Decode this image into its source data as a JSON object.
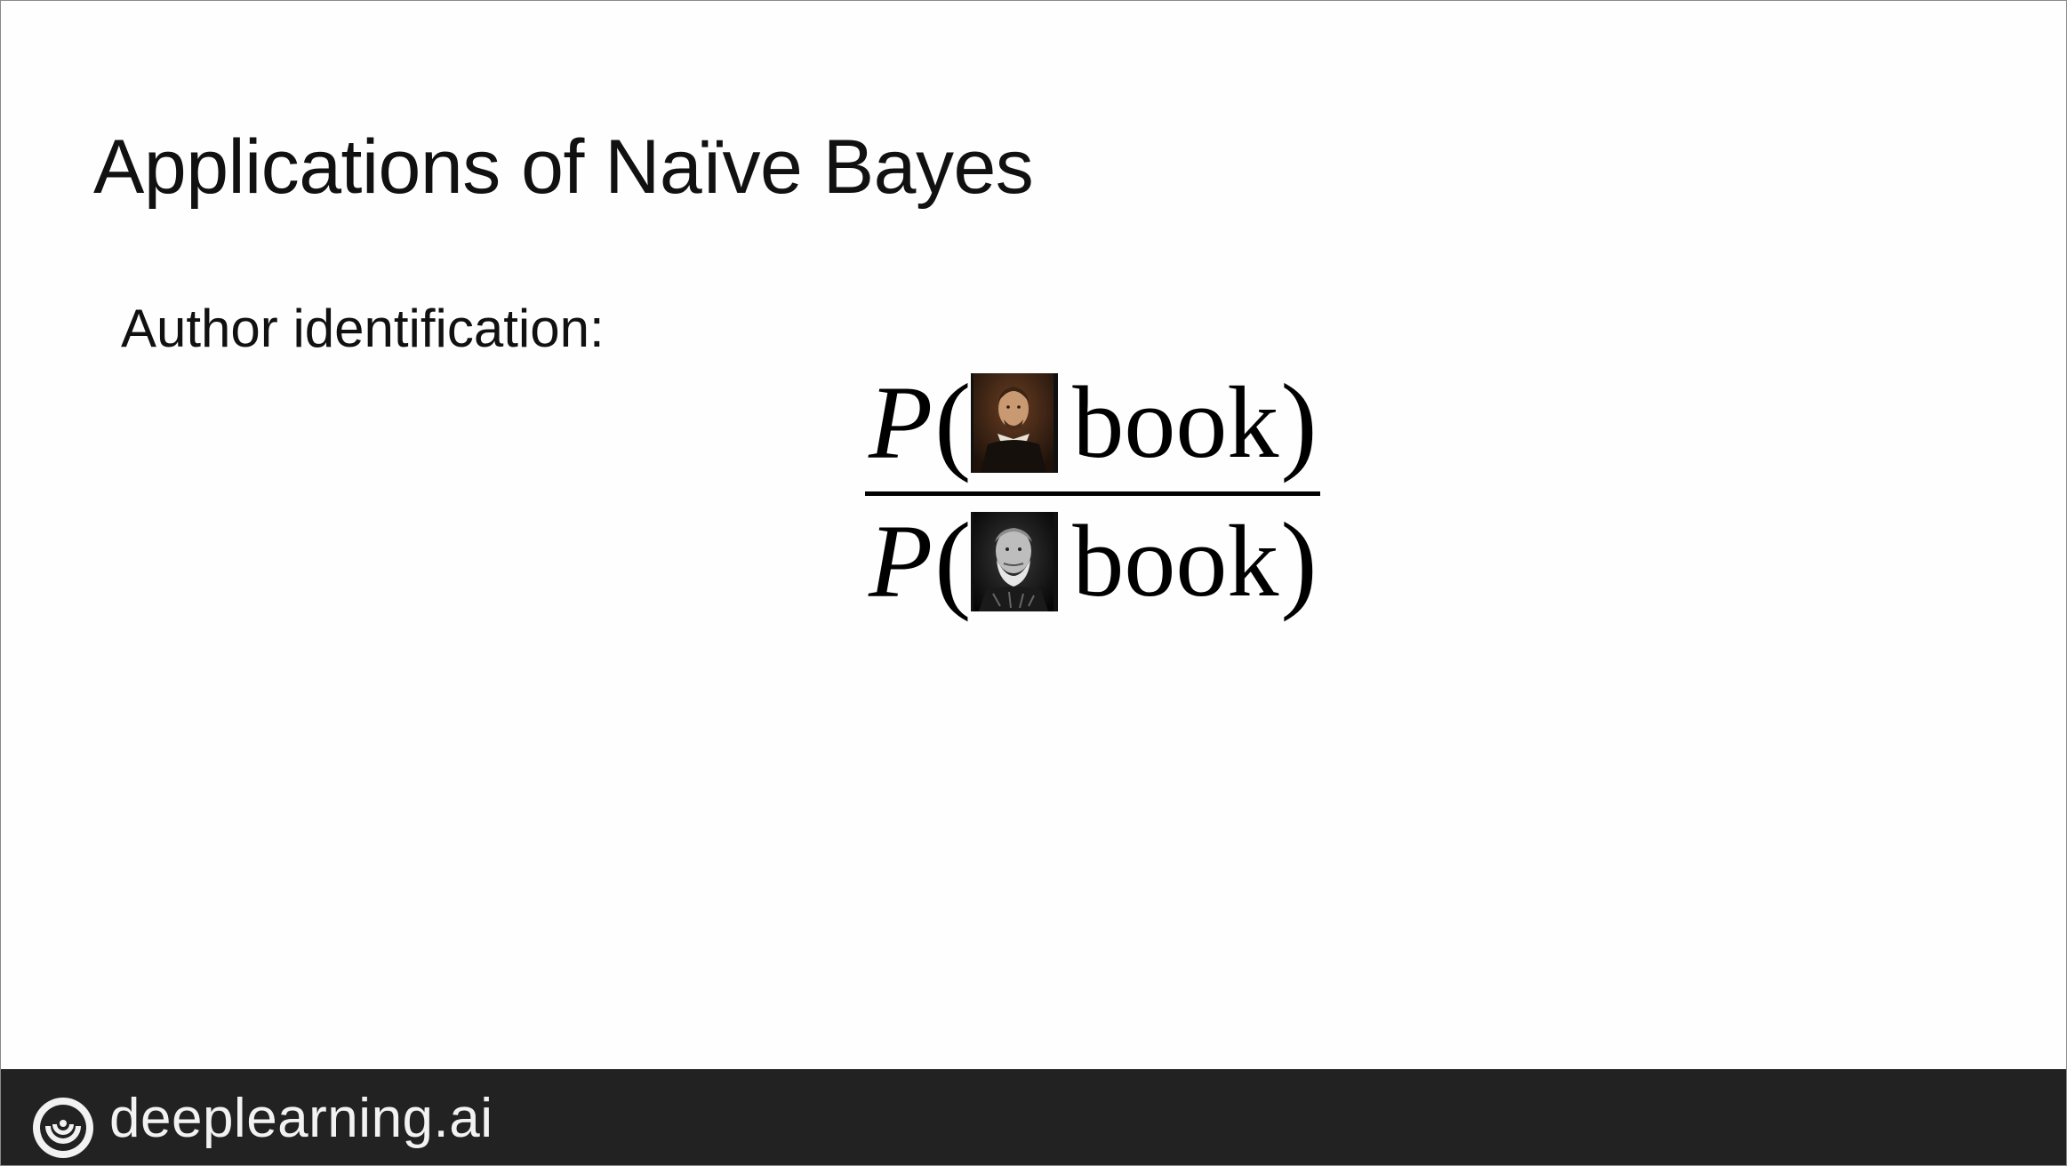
{
  "slide": {
    "title": "Applications of Naïve Bayes",
    "subtitle": "Author identification:"
  },
  "formula": {
    "numerator": {
      "symbol": "P",
      "open_paren": "(",
      "author_image": "shakespeare-portrait",
      "condition": "book",
      "close_paren": ")"
    },
    "denominator": {
      "symbol": "P",
      "open_paren": "(",
      "author_image": "hemingway-portrait",
      "condition": "book",
      "close_paren": ")"
    }
  },
  "footer": {
    "brand": "deeplearning.ai",
    "logo_icon": "deeplearning-logo-icon"
  },
  "colors": {
    "footer_background": "#222222",
    "footer_text": "#f2f2f2",
    "text": "#111111"
  }
}
